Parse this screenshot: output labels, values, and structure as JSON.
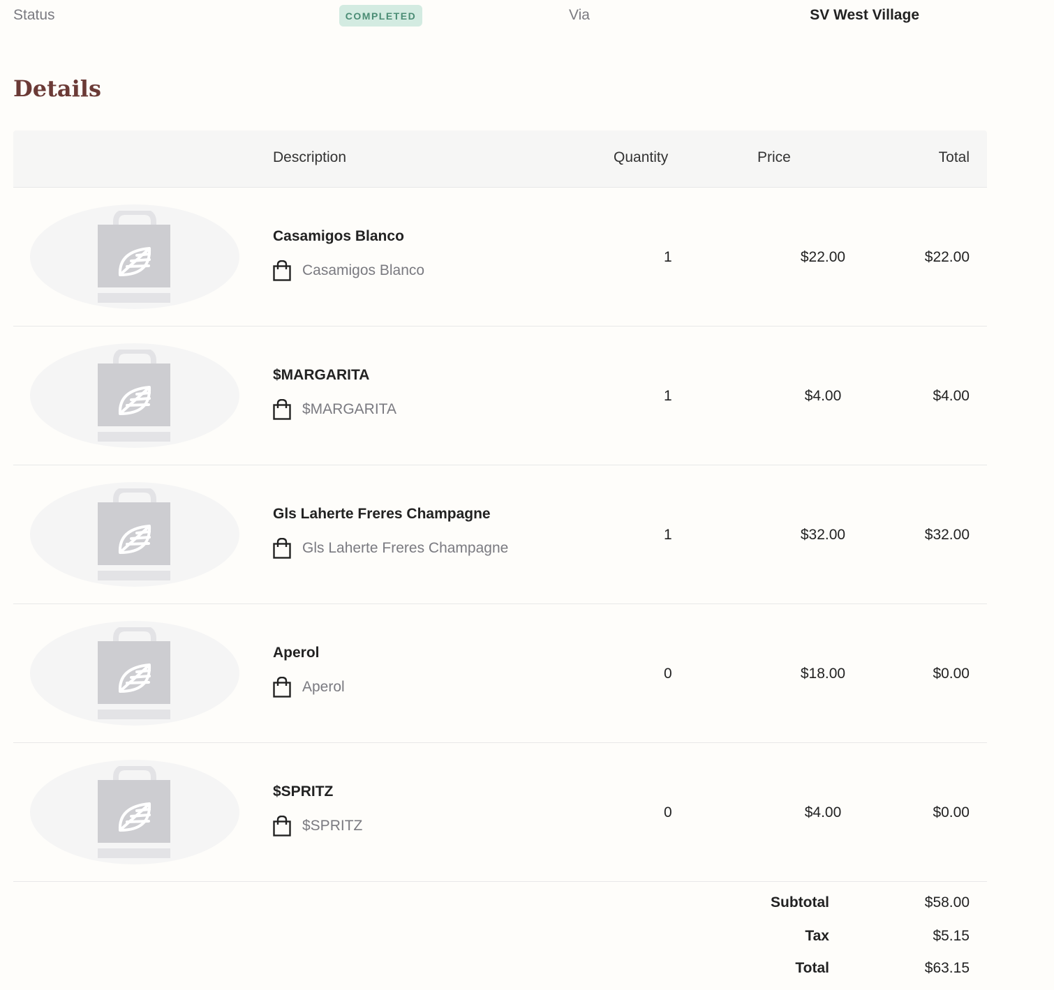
{
  "header": {
    "status_label": "Status",
    "status_badge": "COMPLETED",
    "via_label": "Via",
    "via_value": "SV West Village"
  },
  "details": {
    "title": "Details",
    "columns": {
      "description": "Description",
      "quantity": "Quantity",
      "price": "Price",
      "total": "Total"
    },
    "items": [
      {
        "name": "Casamigos Blanco",
        "sub": "Casamigos Blanco",
        "quantity": "1",
        "price": "$22.00",
        "total": "$22.00"
      },
      {
        "name": "$MARGARITA",
        "sub": "$MARGARITA",
        "quantity": "1",
        "price": "$4.00",
        "total": "$4.00"
      },
      {
        "name": "Gls Laherte Freres Champagne",
        "sub": "Gls Laherte Freres Champagne",
        "quantity": "1",
        "price": "$32.00",
        "total": "$32.00"
      },
      {
        "name": "Aperol",
        "sub": "Aperol",
        "quantity": "0",
        "price": "$18.00",
        "total": "$0.00"
      },
      {
        "name": "$SPRITZ",
        "sub": "$SPRITZ",
        "quantity": "0",
        "price": "$4.00",
        "total": "$0.00"
      }
    ],
    "summary": {
      "subtotal_label": "Subtotal",
      "subtotal_value": "$58.00",
      "tax_label": "Tax",
      "tax_value": "$5.15",
      "total_label": "Total",
      "total_value": "$63.15"
    }
  },
  "icons": {
    "thumbnail": "shopping-bag-leaf-placeholder-icon",
    "item_type": "shopping-bag-icon"
  },
  "colors": {
    "background": "#fefdfa",
    "badge_bg": "#d3ebe1",
    "badge_text": "#4a8c74",
    "title": "#6b3a36",
    "muted_text": "#7a7a80"
  }
}
